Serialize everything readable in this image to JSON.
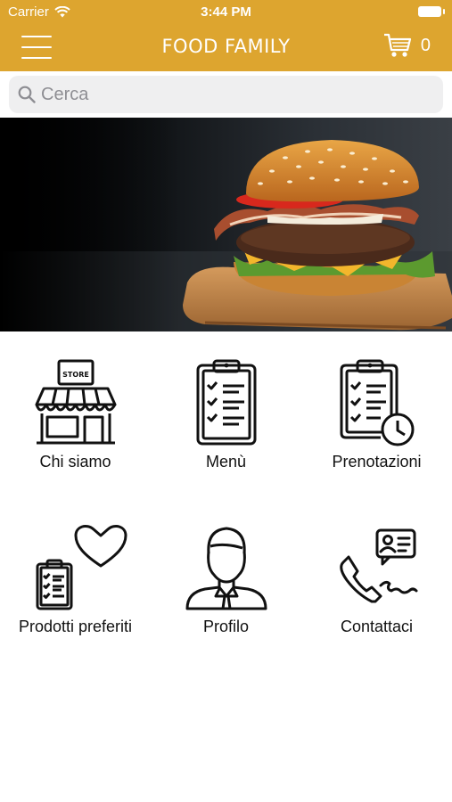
{
  "status_bar": {
    "carrier": "Carrier",
    "time": "3:44 PM"
  },
  "header": {
    "title": "FOOD FAMILY",
    "cart_count": "0",
    "accent_color": "#DDA52F"
  },
  "search": {
    "placeholder": "Cerca",
    "value": ""
  },
  "menu": {
    "items": [
      {
        "label": "Chi siamo",
        "icon": "store-icon"
      },
      {
        "label": "Menù",
        "icon": "clipboard-checklist-icon"
      },
      {
        "label": "Prenotazioni",
        "icon": "clipboard-clock-icon"
      },
      {
        "label": "Prodotti preferiti",
        "icon": "heart-clipboard-icon"
      },
      {
        "label": "Profilo",
        "icon": "user-profile-icon"
      },
      {
        "label": "Contattaci",
        "icon": "phone-contact-icon"
      }
    ]
  }
}
